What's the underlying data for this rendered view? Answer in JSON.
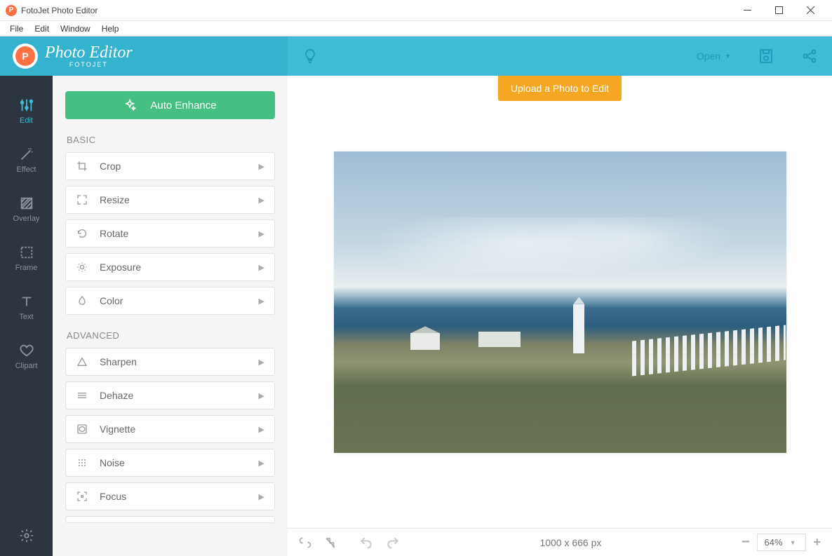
{
  "window": {
    "title": "FotoJet Photo Editor"
  },
  "menubar": [
    "File",
    "Edit",
    "Window",
    "Help"
  ],
  "brand": {
    "main": "Photo Editor",
    "sub": "FOTOJET"
  },
  "header": {
    "open_label": "Open",
    "tooltip": "Upload a Photo to Edit"
  },
  "sidenav": [
    {
      "id": "edit",
      "label": "Edit",
      "icon": "sliders-icon",
      "active": true
    },
    {
      "id": "effect",
      "label": "Effect",
      "icon": "wand-icon"
    },
    {
      "id": "overlay",
      "label": "Overlay",
      "icon": "hatch-icon"
    },
    {
      "id": "frame",
      "label": "Frame",
      "icon": "frame-icon"
    },
    {
      "id": "text",
      "label": "Text",
      "icon": "text-icon"
    },
    {
      "id": "clipart",
      "label": "Clipart",
      "icon": "heart-icon"
    }
  ],
  "panel": {
    "auto_enhance": "Auto Enhance",
    "basic_label": "BASIC",
    "advanced_label": "ADVANCED",
    "basic": [
      {
        "id": "crop",
        "label": "Crop",
        "icon": "crop-icon"
      },
      {
        "id": "resize",
        "label": "Resize",
        "icon": "expand-icon"
      },
      {
        "id": "rotate",
        "label": "Rotate",
        "icon": "rotate-icon"
      },
      {
        "id": "exposure",
        "label": "Exposure",
        "icon": "sun-icon"
      },
      {
        "id": "color",
        "label": "Color",
        "icon": "drop-icon"
      }
    ],
    "advanced": [
      {
        "id": "sharpen",
        "label": "Sharpen",
        "icon": "triangle-icon"
      },
      {
        "id": "dehaze",
        "label": "Dehaze",
        "icon": "lines-icon"
      },
      {
        "id": "vignette",
        "label": "Vignette",
        "icon": "vignette-icon"
      },
      {
        "id": "noise",
        "label": "Noise",
        "icon": "dots-icon"
      },
      {
        "id": "focus",
        "label": "Focus",
        "icon": "focus-icon"
      }
    ]
  },
  "status": {
    "dimensions": "1000 x 666 px",
    "zoom": "64%"
  }
}
